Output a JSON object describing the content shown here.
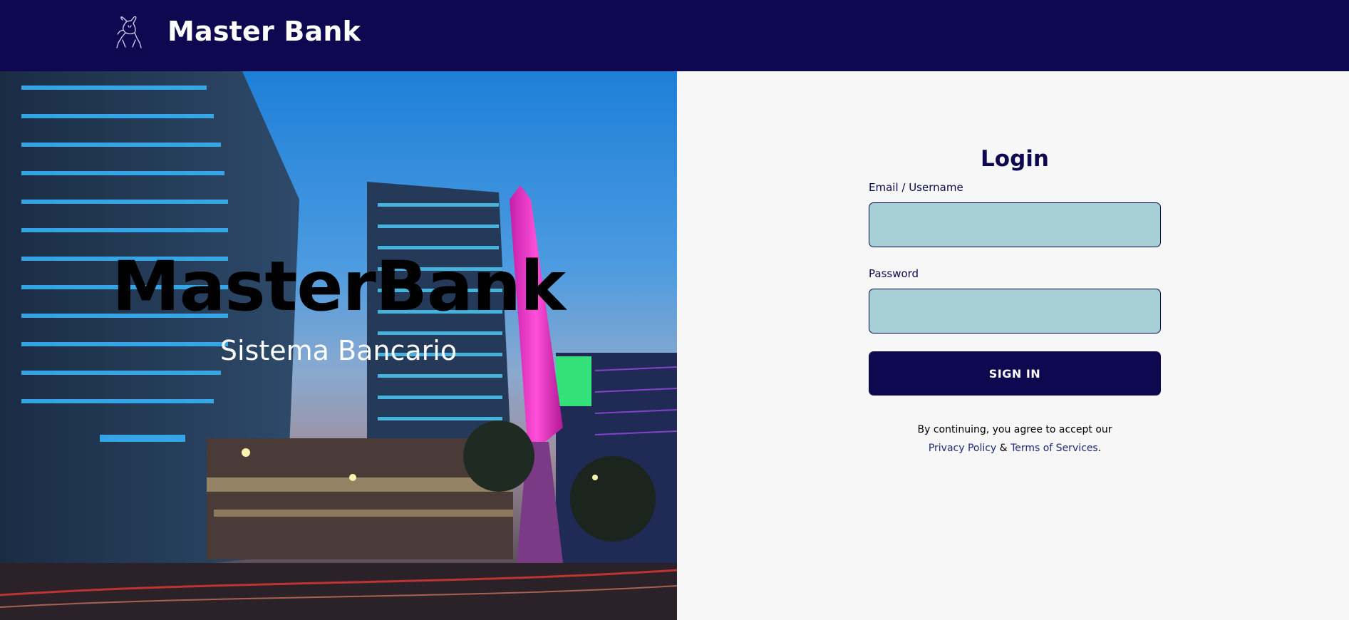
{
  "header": {
    "brand": "Master Bank",
    "logo_icon": "bull-logo-icon"
  },
  "hero": {
    "title": "MasterBank",
    "subtitle": "Sistema Bancario"
  },
  "login": {
    "title": "Login",
    "email_label": "Email / Username",
    "email_value": "",
    "password_label": "Password",
    "password_value": "",
    "signin_label": "SIGN IN",
    "terms_prefix": "By continuing, you agree to accept our",
    "privacy_link": "Privacy Policy",
    "amp": " & ",
    "terms_link": "Terms of Services",
    "terms_suffix": "."
  },
  "colors": {
    "primary": "#0e0850",
    "input_bg": "#a7cfd6",
    "panel_bg": "#f7f7f7"
  }
}
